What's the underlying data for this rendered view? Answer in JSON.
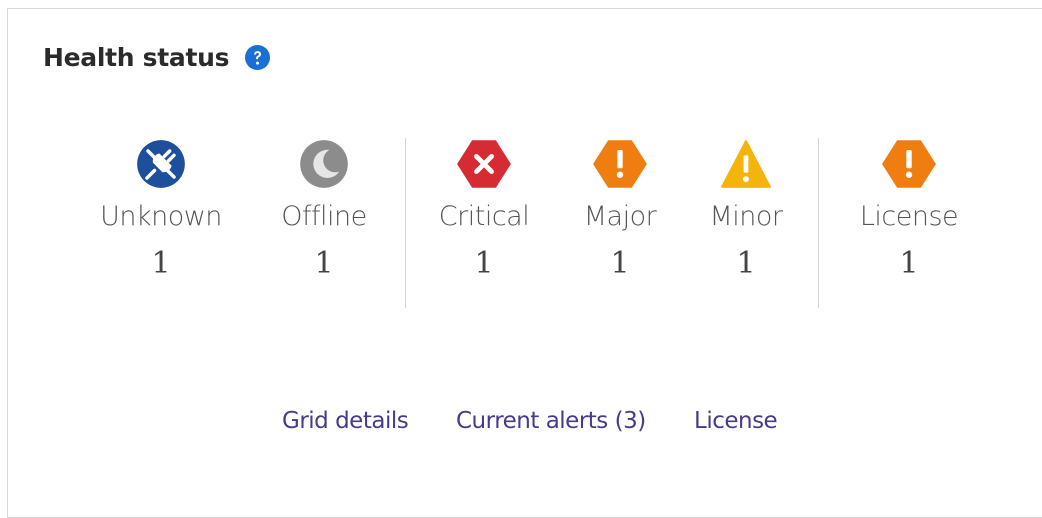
{
  "panel": {
    "title": "Health status"
  },
  "statuses": [
    {
      "label": "Unknown",
      "count": "1",
      "icon": "unplugged-icon",
      "color": "#1e4f9c"
    },
    {
      "label": "Offline",
      "count": "1",
      "icon": "moon-icon",
      "color": "#8c8c8c"
    },
    {
      "label": "Critical",
      "count": "1",
      "icon": "x-octagon-icon",
      "color": "#d62b33"
    },
    {
      "label": "Major",
      "count": "1",
      "icon": "exclamation-hexagon-icon",
      "color": "#f07d10"
    },
    {
      "label": "Minor",
      "count": "1",
      "icon": "warning-triangle-icon",
      "color": "#f5b40b"
    },
    {
      "label": "License",
      "count": "1",
      "icon": "exclamation-hexagon-icon",
      "color": "#f07d10"
    }
  ],
  "links": {
    "grid_details": "Grid details",
    "current_alerts": "Current alerts (3)",
    "license": "License"
  },
  "colors": {
    "help_icon": "#1a6fd6",
    "link": "#4a3a8c"
  }
}
